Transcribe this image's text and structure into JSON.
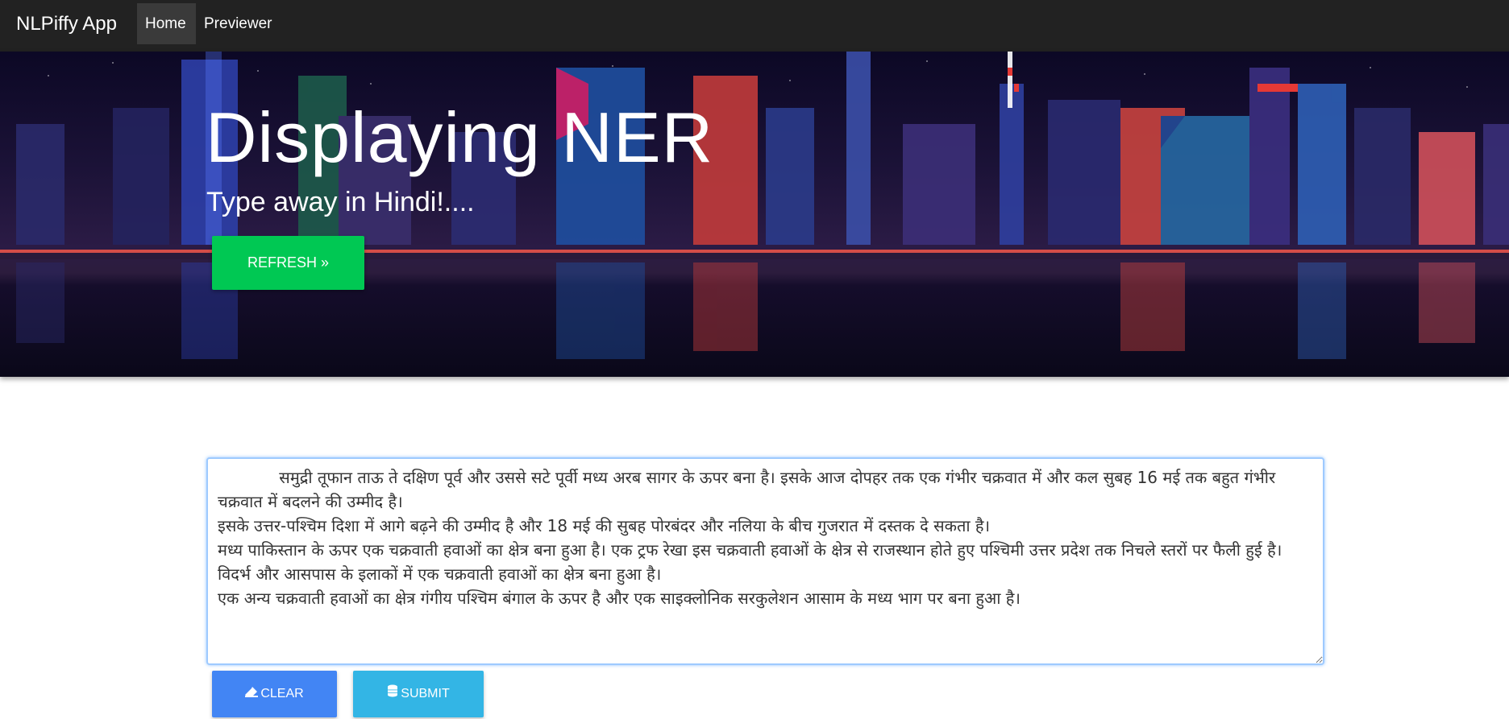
{
  "navbar": {
    "brand": "NLPiffy App",
    "items": [
      {
        "label": "Home",
        "active": true
      },
      {
        "label": "Previewer",
        "active": false
      }
    ]
  },
  "hero": {
    "title": "Displaying NER",
    "subtitle": "Type away in Hindi!....",
    "refresh_label": "REFRESH »"
  },
  "editor": {
    "value": "            समुद्री तूफान ताऊ ते दक्षिण पूर्व और उससे सटे पूर्वी मध्य अरब सागर के ऊपर बना है। इसके आज दोपहर तक एक गंभीर चक्रवात में और कल सुबह 16 मई तक बहुत गंभीर चक्रवात में बदलने की उम्मीद है।\nइसके उत्तर-पश्चिम दिशा में आगे बढ़ने की उम्मीद है और 18 मई की सुबह पोरबंदर और नलिया के बीच गुजरात में दस्तक दे सकता है।\nमध्य पाकिस्तान के ऊपर एक चक्रवाती हवाओं का क्षेत्र बना हुआ है। एक ट्रफ रेखा इस चक्रवाती हवाओं के क्षेत्र से राजस्थान होते हुए पश्चिमी उत्तर प्रदेश तक निचले स्तरों पर फैली हुई है।\nविदर्भ और आसपास के इलाकों में एक चक्रवाती हवाओं का क्षेत्र बना हुआ है।\nएक अन्य चक्रवाती हवाओं का क्षेत्र गंगीय पश्चिम बंगाल के ऊपर है और एक साइक्लोनिक सरकुलेशन आसाम के मध्य भाग पर बना हुआ है।"
  },
  "actions": {
    "clear_label": "CLEAR",
    "clear_icon": "eraser-icon",
    "submit_label": "SUBMIT",
    "submit_icon": "database-icon"
  },
  "colors": {
    "navbar": "#222222",
    "refresh": "#00c853",
    "clear": "#4285f4",
    "submit": "#33b5e5"
  }
}
